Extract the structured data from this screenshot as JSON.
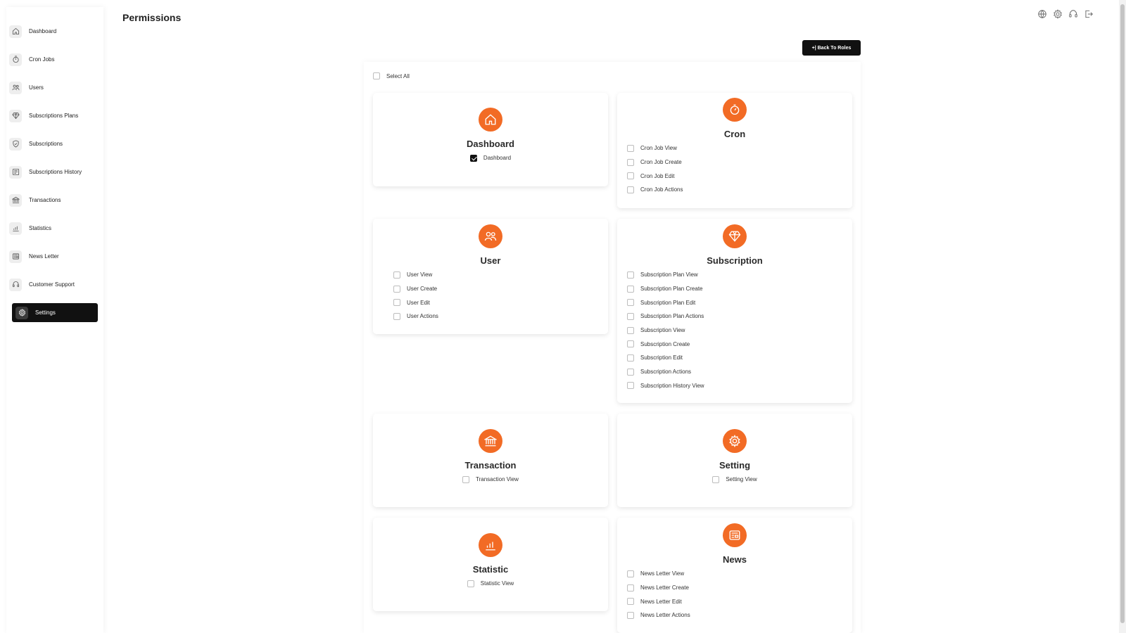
{
  "page_title": "Permissions",
  "back_button_label": "+| Back To Roles",
  "select_all_label": "Select All",
  "accent_color": "#f26b25",
  "sidebar": {
    "items": [
      {
        "label": "Dashboard",
        "icon": "home-icon"
      },
      {
        "label": "Cron Jobs",
        "icon": "timer-icon"
      },
      {
        "label": "Users",
        "icon": "users-icon"
      },
      {
        "label": "Subscriptions Plans",
        "icon": "diamond-icon"
      },
      {
        "label": "Subscriptions",
        "icon": "shield-icon"
      },
      {
        "label": "Subscriptions History",
        "icon": "history-icon"
      },
      {
        "label": "Transactions",
        "icon": "bank-icon"
      },
      {
        "label": "Statistics",
        "icon": "chart-icon"
      },
      {
        "label": "News Letter",
        "icon": "newspaper-icon"
      },
      {
        "label": "Customer Support",
        "icon": "headset-icon"
      },
      {
        "label": "Settings",
        "icon": "gear-icon",
        "active": true
      }
    ]
  },
  "header_icons": [
    "globe-icon",
    "gear-icon",
    "headset-icon",
    "logout-icon"
  ],
  "cards": {
    "dashboard": {
      "title": "Dashboard",
      "perms": [
        {
          "label": "Dashboard",
          "checked": true
        }
      ]
    },
    "cron": {
      "title": "Cron",
      "perms": [
        {
          "label": "Cron Job View",
          "checked": false
        },
        {
          "label": "Cron Job Create",
          "checked": false
        },
        {
          "label": "Cron Job Edit",
          "checked": false
        },
        {
          "label": "Cron Job Actions",
          "checked": false
        }
      ]
    },
    "user": {
      "title": "User",
      "perms": [
        {
          "label": "User View",
          "checked": false
        },
        {
          "label": "User Create",
          "checked": false
        },
        {
          "label": "User Edit",
          "checked": false
        },
        {
          "label": "User Actions",
          "checked": false
        }
      ]
    },
    "subscription": {
      "title": "Subscription",
      "perms": [
        {
          "label": "Subscription Plan View",
          "checked": false
        },
        {
          "label": "Subscription Plan Create",
          "checked": false
        },
        {
          "label": "Subscription Plan Edit",
          "checked": false
        },
        {
          "label": "Subscription Plan Actions",
          "checked": false
        },
        {
          "label": "Subscription View",
          "checked": false
        },
        {
          "label": "Subscription Create",
          "checked": false
        },
        {
          "label": "Subscription Edit",
          "checked": false
        },
        {
          "label": "Subscription Actions",
          "checked": false
        },
        {
          "label": "Subscription History View",
          "checked": false
        }
      ]
    },
    "transaction": {
      "title": "Transaction",
      "perms": [
        {
          "label": "Transaction View",
          "checked": false
        }
      ]
    },
    "setting": {
      "title": "Setting",
      "perms": [
        {
          "label": "Setting View",
          "checked": false
        }
      ]
    },
    "statistic": {
      "title": "Statistic",
      "perms": [
        {
          "label": "Statistic View",
          "checked": false
        }
      ]
    },
    "news": {
      "title": "News",
      "perms": [
        {
          "label": "News Letter View",
          "checked": false
        },
        {
          "label": "News Letter Create",
          "checked": false
        },
        {
          "label": "News Letter Edit",
          "checked": false
        },
        {
          "label": "News Letter Actions",
          "checked": false
        }
      ]
    }
  }
}
